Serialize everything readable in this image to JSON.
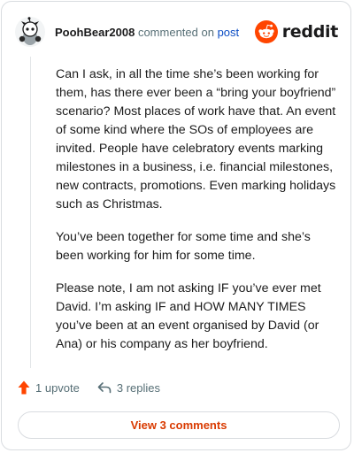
{
  "comment": {
    "author": "PoohBear2008",
    "action_text": "commented on",
    "post_link": "post",
    "paragraphs": [
      "Can I ask, in all the time she’s been working for them, has there ever been a “bring your boyfriend” scenario? Most places of work have that. An event of some kind where the SOs of employees are invited. People have celebratory events marking milestones in a business, i.e. financial milestones, new contracts, promotions. Even marking holidays such as Christmas.",
      "You’ve been together for some time and she’s been working for him for some time.",
      "Please note, I am not asking IF you’ve ever met David. I’m asking IF and HOW MANY TIMES you’ve been at an event organised by David (or Ana) or his company as her boyfriend."
    ]
  },
  "brand": {
    "wordmark": "reddit",
    "logo_icon": "reddit-snoo-icon",
    "color": "#ff4500"
  },
  "actions": {
    "upvote_icon": "upvote-arrow-icon",
    "upvote_label": "1 upvote",
    "reply_icon": "reply-arrow-icon",
    "replies_label": "3 replies"
  },
  "view_comments_label": "View 3 comments",
  "colors": {
    "accent": "#d93a00",
    "upvote": "#ff4500",
    "link": "#0a4cc4"
  }
}
